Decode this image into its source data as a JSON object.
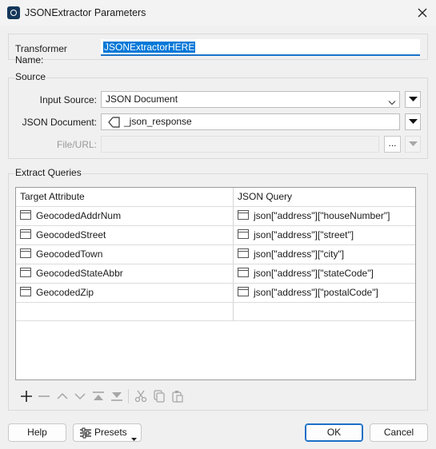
{
  "window": {
    "title": "JSONExtractor Parameters"
  },
  "transformer": {
    "label": "Transformer Name:",
    "value": "JSONExtractorHERE"
  },
  "source": {
    "group_label": "Source",
    "input_source_label": "Input Source:",
    "input_source_value": "JSON Document",
    "json_document_label": "JSON Document:",
    "json_document_value": "_json_response",
    "file_url_label": "File/URL:",
    "file_url_value": "",
    "browse_label": "..."
  },
  "extract_queries": {
    "group_label": "Extract Queries",
    "columns": [
      "Target Attribute",
      "JSON Query"
    ],
    "rows": [
      {
        "attribute": "GeocodedAddrNum",
        "query": "json[\"address\"][\"houseNumber\"]"
      },
      {
        "attribute": "GeocodedStreet",
        "query": "json[\"address\"][\"street\"]"
      },
      {
        "attribute": "GeocodedTown",
        "query": "json[\"address\"][\"city\"]"
      },
      {
        "attribute": "GeocodedStateAbbr",
        "query": "json[\"address\"][\"stateCode\"]"
      },
      {
        "attribute": "GeocodedZip",
        "query": "json[\"address\"][\"postalCode\"]"
      }
    ]
  },
  "footer": {
    "help_label": "Help",
    "presets_label": "Presets",
    "ok_label": "OK",
    "cancel_label": "Cancel"
  },
  "colors": {
    "accent": "#0078d7",
    "window_bg": "#f0f0f0"
  }
}
